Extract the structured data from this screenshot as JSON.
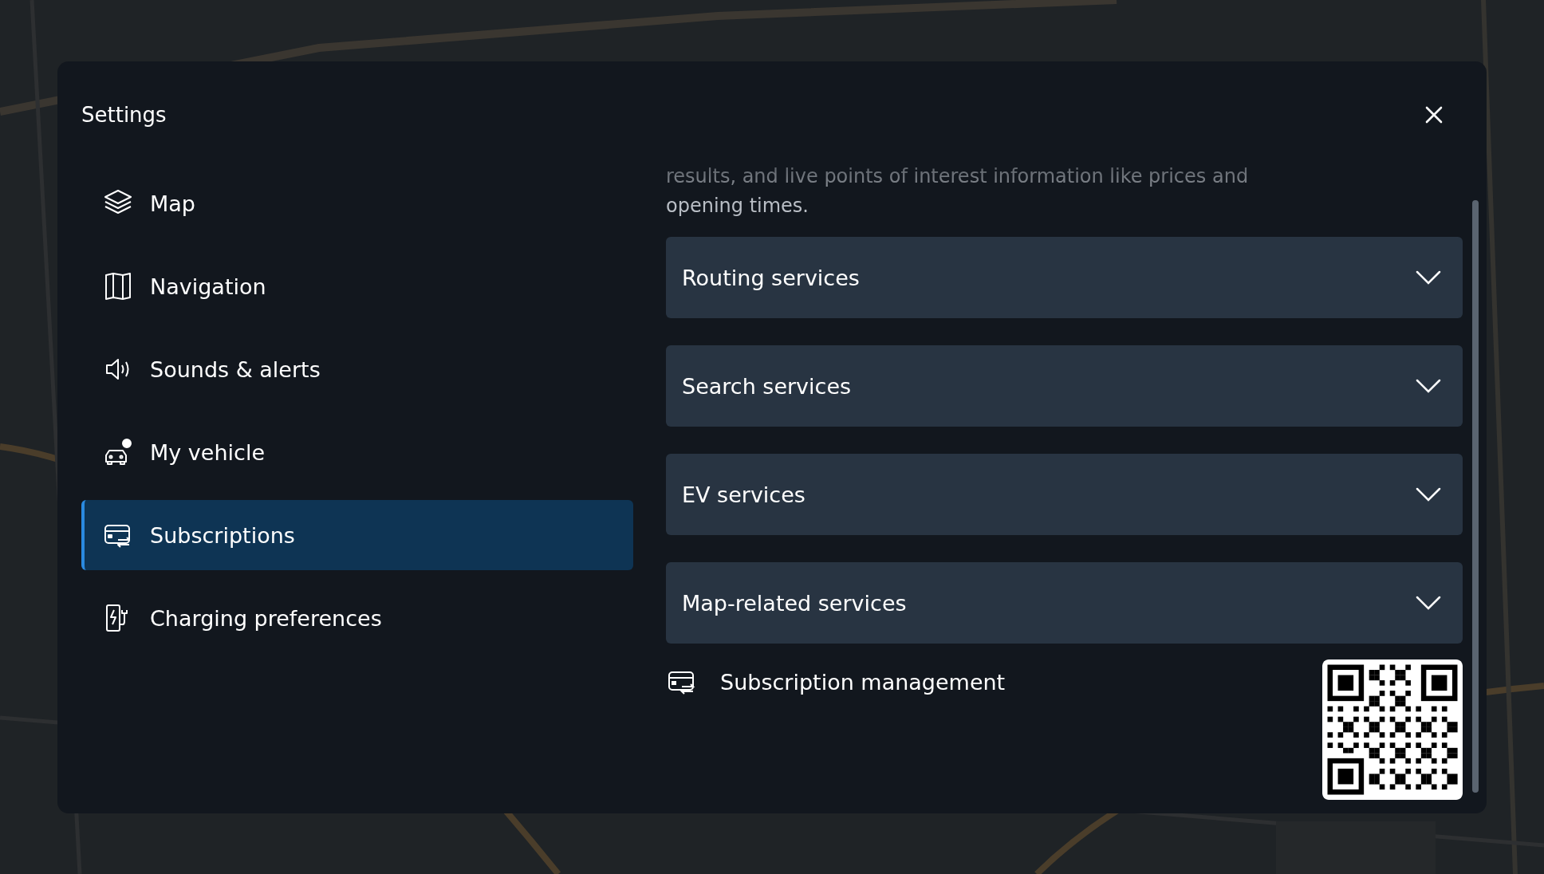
{
  "dialog": {
    "title": "Settings"
  },
  "sidebar": {
    "items": [
      {
        "label": "Map",
        "selected": false
      },
      {
        "label": "Navigation",
        "selected": false
      },
      {
        "label": "Sounds & alerts",
        "selected": false
      },
      {
        "label": "My vehicle",
        "selected": false
      },
      {
        "label": "Subscriptions",
        "selected": true
      },
      {
        "label": "Charging preferences",
        "selected": false
      }
    ]
  },
  "content": {
    "description": "results, and live points of interest information like prices and opening times.",
    "sections": [
      {
        "title": "Routing services",
        "expanded": false
      },
      {
        "title": "Search services",
        "expanded": false
      },
      {
        "title": "EV services",
        "expanded": false
      },
      {
        "title": "Map-related services",
        "expanded": false
      }
    ],
    "subscription_management": {
      "label": "Subscription management"
    }
  }
}
